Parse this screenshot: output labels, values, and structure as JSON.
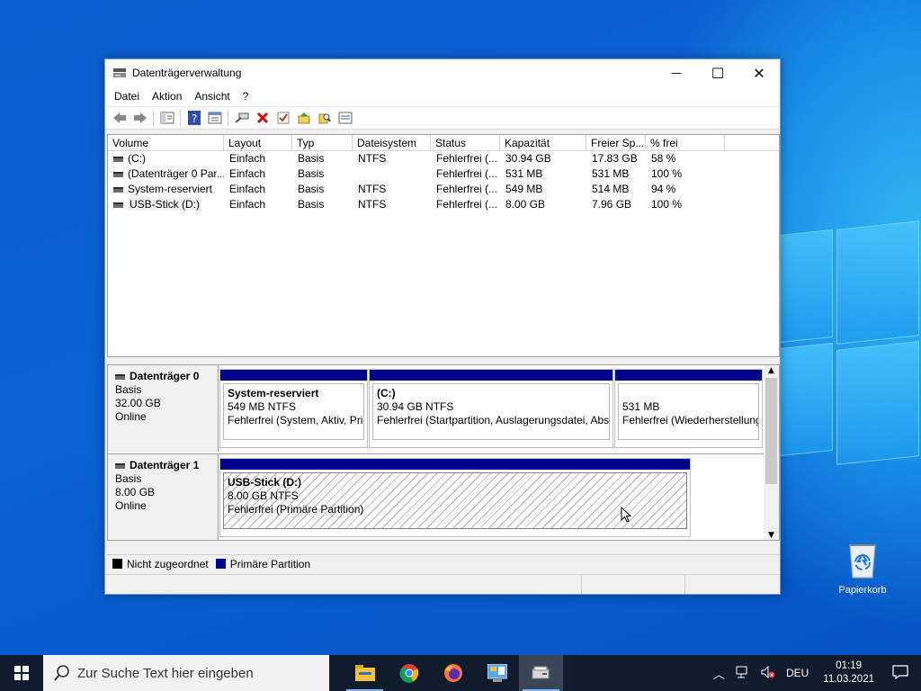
{
  "window": {
    "title": "Datenträgerverwaltung",
    "controls": {
      "minimize": "—",
      "maximize": "☐",
      "close": "✕"
    }
  },
  "menu": [
    "Datei",
    "Aktion",
    "Ansicht",
    "?"
  ],
  "toolbar_icons": [
    "back-icon",
    "forward-icon",
    "console-tree-icon",
    "help-icon",
    "properties-icon",
    "connect-icon",
    "delete-icon",
    "check-icon",
    "import-icon",
    "search-icon",
    "list-view-icon"
  ],
  "volumes": {
    "headers": [
      "Volume",
      "Layout",
      "Typ",
      "Dateisystem",
      "Status",
      "Kapazität",
      "Freier Sp...",
      "% frei"
    ],
    "rows": [
      [
        "(C:)",
        "Einfach",
        "Basis",
        "NTFS",
        "Fehlerfrei (...",
        "30.94 GB",
        "17.83 GB",
        "58 %"
      ],
      [
        "(Datenträger 0 Par...",
        "Einfach",
        "Basis",
        "",
        "Fehlerfrei (...",
        "531 MB",
        "531 MB",
        "100 %"
      ],
      [
        "System-reserviert",
        "Einfach",
        "Basis",
        "NTFS",
        "Fehlerfrei (...",
        "549 MB",
        "514 MB",
        "94 %"
      ],
      [
        "USB-Stick (D:)",
        "Einfach",
        "Basis",
        "NTFS",
        "Fehlerfrei (...",
        "8.00 GB",
        "7.96 GB",
        "100 %"
      ]
    ]
  },
  "disks": [
    {
      "name": "Datenträger 0",
      "type": "Basis",
      "size": "32.00 GB",
      "status": "Online",
      "partitions": [
        {
          "title": "System-reserviert",
          "size": "549 MB NTFS",
          "status": "Fehlerfrei (System, Aktiv, Primäre Partition)"
        },
        {
          "title": "(C:)",
          "size": "30.94 GB NTFS",
          "status": "Fehlerfrei (Startpartition, Auslagerungsdatei, Absturzabbild, Primäre Partition)"
        },
        {
          "title": "",
          "size": "531 MB",
          "status": "Fehlerfrei (Wiederherstellungspartition)"
        }
      ]
    },
    {
      "name": "Datenträger 1",
      "type": "Basis",
      "size": "8.00 GB",
      "status": "Online",
      "partitions": [
        {
          "title": "USB-Stick  (D:)",
          "size": "8.00 GB NTFS",
          "status": "Fehlerfrei (Primäre Partition)"
        }
      ]
    }
  ],
  "legend": [
    {
      "label": "Nicht zugeordnet",
      "color": "#000000"
    },
    {
      "label": "Primäre Partition",
      "color": "#00008a"
    }
  ],
  "desktop": {
    "recycle_bin": "Papierkorb"
  },
  "taskbar": {
    "search_placeholder": "Zur Suche Text hier eingeben",
    "apps": [
      "file-explorer-icon",
      "chrome-icon",
      "firefox-icon",
      "control-panel-icon",
      "disk-management-icon"
    ],
    "language": "DEU",
    "time": "01:19",
    "date": "11.03.2021"
  }
}
